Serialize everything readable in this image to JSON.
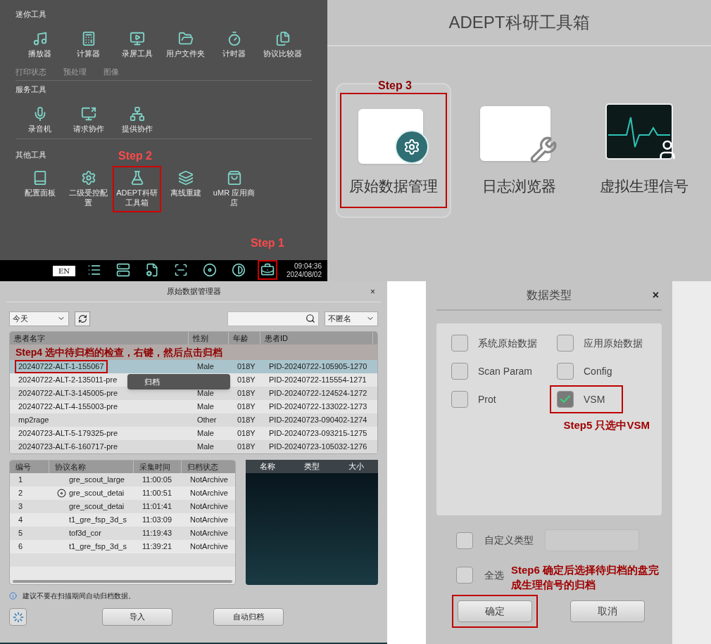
{
  "launcher": {
    "ghost_labels": [
      "打印状态",
      "预处理",
      "图像"
    ],
    "sections": [
      {
        "title": "迷你工具",
        "tools": [
          {
            "label": "播放器",
            "highlighted": false
          },
          {
            "label": "计算器",
            "highlighted": false
          },
          {
            "label": "录屏工具",
            "highlighted": false
          },
          {
            "label": "用户文件夹",
            "highlighted": false
          },
          {
            "label": "计时器",
            "highlighted": false
          },
          {
            "label": "协议比较器",
            "highlighted": false
          }
        ]
      },
      {
        "title": "服务工具",
        "tools": [
          {
            "label": "录音机",
            "highlighted": false
          },
          {
            "label": "请求协作",
            "highlighted": false
          },
          {
            "label": "提供协作",
            "highlighted": false
          }
        ]
      },
      {
        "title": "其他工具",
        "tools": [
          {
            "label": "配置面板",
            "highlighted": false
          },
          {
            "label": "二级受控配置",
            "highlighted": false
          },
          {
            "label": "ADEPT科研工具箱",
            "highlighted": true,
            "step": "Step 2"
          },
          {
            "label": "离线重建",
            "highlighted": false
          },
          {
            "label": "uMR 应用商店",
            "highlighted": false
          }
        ]
      }
    ],
    "taskbar": {
      "language": "EN",
      "icons": [
        {
          "highlighted": false
        },
        {
          "highlighted": false
        },
        {
          "highlighted": false
        },
        {
          "highlighted": false
        },
        {
          "highlighted": false
        },
        {
          "highlighted": false
        },
        {
          "highlighted": true,
          "step": "Step 1"
        }
      ],
      "time": "09:04:36",
      "date": "2024/08/02"
    }
  },
  "toolbox": {
    "title": "ADEPT科研工具箱",
    "apps": [
      {
        "label": "原始数据管理",
        "highlighted": true,
        "step": "Step 3"
      },
      {
        "label": "日志浏览器",
        "highlighted": false
      },
      {
        "label": "虚拟生理信号",
        "highlighted": false
      }
    ]
  },
  "manager": {
    "title": "原始数据管理器",
    "close": "×",
    "date_filter": "今天",
    "anonymize": "不匿名",
    "columns": [
      "患者名字",
      "性别",
      "年龄",
      "患者ID"
    ],
    "annotation": "Step4  选中待归档的检查，右键，然后点击归档",
    "rows": [
      {
        "name": "20240722-ALT-1-155067",
        "sex": "Male",
        "age": "018Y",
        "id": "PID-20240722-105905-1270",
        "selected": true,
        "highlighted": true
      },
      {
        "name": "20240722-ALT-2-135011-pre",
        "age": "018Y",
        "id": "PID-20240722-115554-1271",
        "selected": false,
        "highlighted": false
      },
      {
        "name": "20240722-ALT-3-145005-pre",
        "sex": "Male",
        "age": "018Y",
        "id": "PID-20240722-124524-1272",
        "selected": false,
        "highlighted": false
      },
      {
        "name": "20240722-ALT-4-155003-pre",
        "sex": "Male",
        "age": "018Y",
        "id": "PID-20240722-133022-1273",
        "selected": false,
        "highlighted": false
      },
      {
        "name": "mp2rage",
        "sex": "Other",
        "age": "018Y",
        "id": "PID-20240723-090402-1274",
        "selected": false,
        "highlighted": false
      },
      {
        "name": "20240723-ALT-5-179325-pre",
        "sex": "Male",
        "age": "018Y",
        "id": "PID-20240723-093215-1275",
        "selected": false,
        "highlighted": false
      },
      {
        "name": "20240723-ALT-6-160717-pre",
        "sex": "Male",
        "age": "018Y",
        "id": "PID-20240723-105032-1276",
        "selected": false,
        "highlighted": false
      }
    ],
    "context_menu": [
      "归档"
    ],
    "series_columns": [
      "编号",
      "协议名称",
      "采集时间",
      "归档状态"
    ],
    "series_rows": [
      {
        "cells": [
          "1",
          "gre_scout_large",
          "11:00:05",
          "NotArchive"
        ],
        "flag": false
      },
      {
        "cells": [
          "2",
          "gre_scout_detai",
          "11:00:51",
          "NotArchive"
        ],
        "flag": true
      },
      {
        "cells": [
          "3",
          "gre_scout_detai",
          "11:01:41",
          "NotArchive"
        ],
        "flag": false
      },
      {
        "cells": [
          "4",
          "t1_gre_fsp_3d_s",
          "11:03:09",
          "NotArchive"
        ],
        "flag": false
      },
      {
        "cells": [
          "5",
          "tof3d_cor",
          "11:19:43",
          "NotArchive"
        ],
        "flag": false
      },
      {
        "cells": [
          "6",
          "t1_gre_fsp_3d_s",
          "11:39:21",
          "NotArchive"
        ],
        "flag": false
      }
    ],
    "preview_columns": [
      "名称",
      "类型",
      "大小"
    ],
    "info": "建议不要在扫描期间自动归档数据。",
    "buttons": [
      "导入",
      "自动归档"
    ]
  },
  "dialog": {
    "title": "数据类型",
    "close": "×",
    "options": [
      {
        "label": "系统原始数据",
        "checked": false,
        "highlighted": false
      },
      {
        "label": "应用原始数据",
        "checked": false,
        "highlighted": false
      },
      {
        "label": "Scan Param",
        "checked": false,
        "highlighted": false
      },
      {
        "label": "Config",
        "checked": false,
        "highlighted": false
      },
      {
        "label": "Prot",
        "checked": false,
        "highlighted": false
      },
      {
        "label": "VSM",
        "checked": true,
        "highlighted": true
      }
    ],
    "option_note": "Step5 只选中VSM",
    "custom": {
      "label": "自定义类型",
      "checked": false
    },
    "select_all": {
      "label": "全选",
      "checked": false
    },
    "note": "Step6 确定后选择待归档的盘完成生理信号的归档",
    "buttons": [
      {
        "label": "确定",
        "highlighted": true
      },
      {
        "label": "取消",
        "highlighted": false
      }
    ]
  }
}
